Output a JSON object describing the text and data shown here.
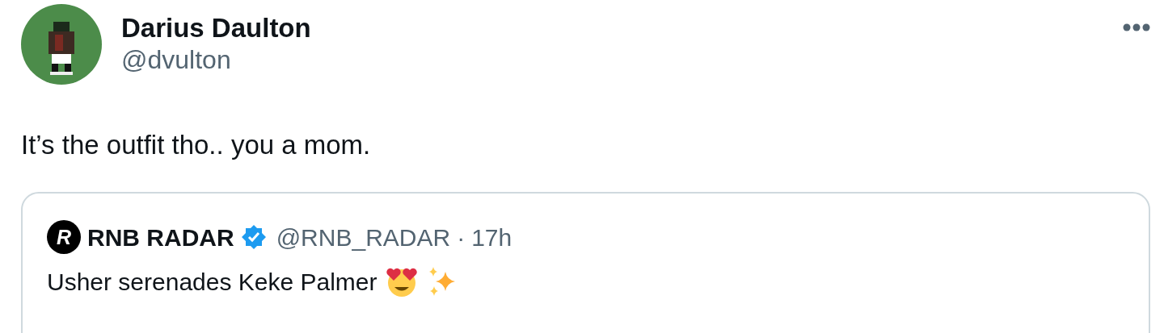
{
  "author": {
    "name": "Darius Daulton",
    "handle": "@dvulton"
  },
  "text": "It’s the outfit tho.. you a mom.",
  "quote": {
    "logo_letter": "R",
    "name": "RNB RADAR",
    "verified": true,
    "handle": "@RNB_RADAR",
    "separator": "·",
    "time": "17h",
    "text": "Usher serenades Keke Palmer"
  }
}
